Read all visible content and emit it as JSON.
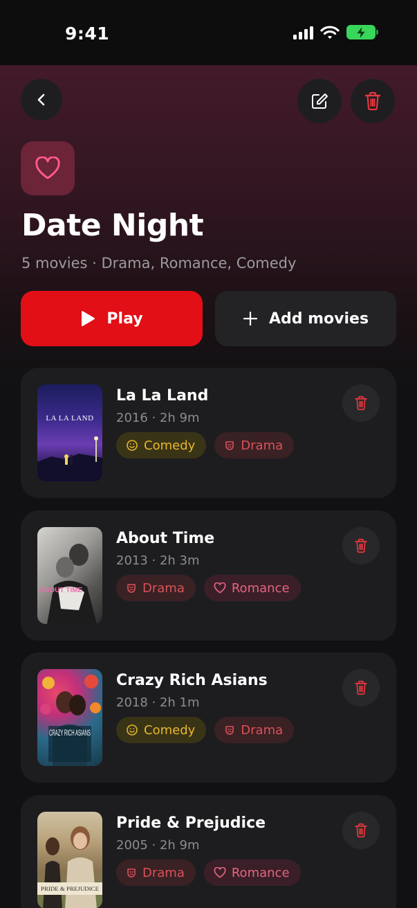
{
  "status_bar": {
    "time": "9:41"
  },
  "playlist": {
    "title": "Date Night",
    "subtitle": "5 movies · Drama, Romance, Comedy",
    "icon": "heart-icon"
  },
  "actions": {
    "play_label": "Play",
    "add_label": "Add movies"
  },
  "colors": {
    "accent_red": "#e20f16",
    "comedy": "#e7b72c",
    "drama": "#d9525a",
    "romance": "#e4647f",
    "heart": "#ff5a86"
  },
  "movies": [
    {
      "title": "La La Land",
      "meta": "2016 · 2h 9m",
      "poster_text": "LA LA LAND",
      "tags": [
        {
          "label": "Comedy",
          "icon": "smiley-icon"
        },
        {
          "label": "Drama",
          "icon": "mask-icon"
        }
      ]
    },
    {
      "title": "About Time",
      "meta": "2013 · 2h 3m",
      "poster_text": "ABOUT TIME",
      "tags": [
        {
          "label": "Drama",
          "icon": "mask-icon"
        },
        {
          "label": "Romance",
          "icon": "heart-icon"
        }
      ]
    },
    {
      "title": "Crazy Rich Asians",
      "meta": "2018 · 2h 1m",
      "poster_text": "CRAZY RICH ASIANS",
      "tags": [
        {
          "label": "Comedy",
          "icon": "smiley-icon"
        },
        {
          "label": "Drama",
          "icon": "mask-icon"
        }
      ]
    },
    {
      "title": "Pride & Prejudice",
      "meta": "2005 · 2h 9m",
      "poster_text": "PRIDE & PREJUDICE",
      "tags": [
        {
          "label": "Drama",
          "icon": "mask-icon"
        },
        {
          "label": "Romance",
          "icon": "heart-icon"
        }
      ]
    }
  ]
}
